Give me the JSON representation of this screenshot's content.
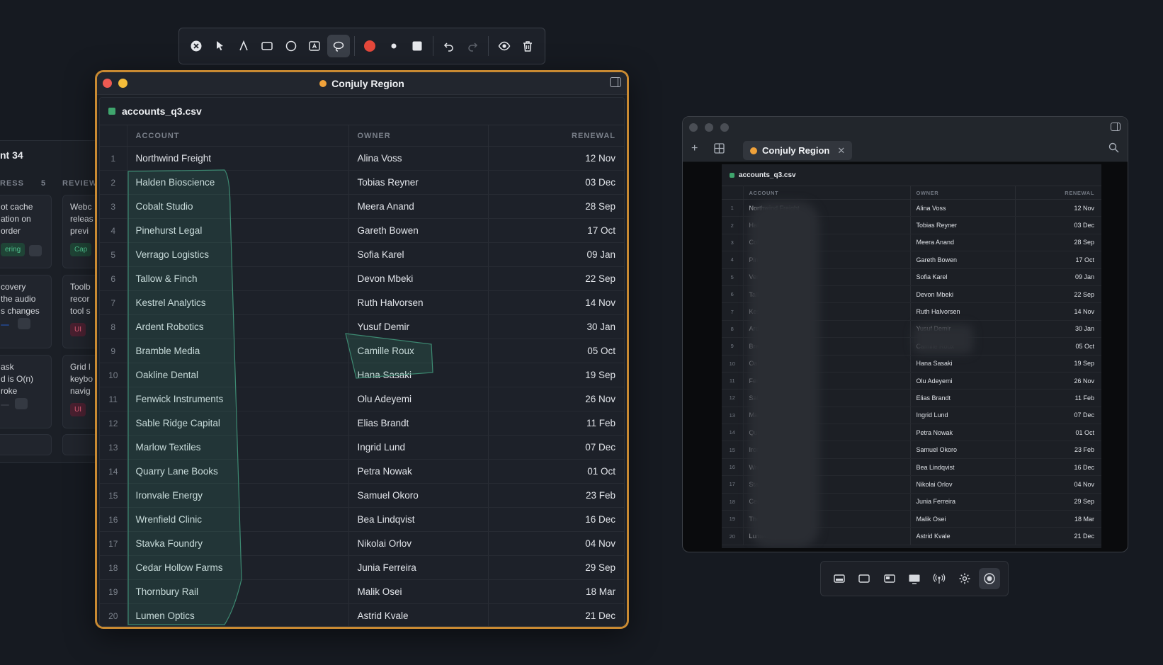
{
  "toolbar": {
    "tools": [
      {
        "name": "close-icon"
      },
      {
        "name": "arrow-pointer-icon"
      },
      {
        "name": "pen-icon"
      },
      {
        "name": "rectangle-icon"
      },
      {
        "name": "ellipse-icon"
      },
      {
        "name": "text-box-icon"
      },
      {
        "name": "lasso-icon",
        "active": true
      },
      {
        "name": "color-red-swatch",
        "color": "#e5483b"
      },
      {
        "name": "stroke-dot-icon"
      },
      {
        "name": "fill-square-icon"
      },
      {
        "name": "undo-icon"
      },
      {
        "name": "redo-icon"
      },
      {
        "name": "eye-icon"
      },
      {
        "name": "trash-icon"
      }
    ]
  },
  "kanban": {
    "title": "nt 34",
    "col1": "RESS",
    "col1_count": "5",
    "col2": "REVIEW",
    "cards_left": [
      {
        "lines": [
          "ot cache",
          "ation on",
          "order"
        ],
        "tag": "ering"
      },
      {
        "lines": [
          "covery",
          "the audio",
          "s changes"
        ],
        "tag": ""
      },
      {
        "lines": [
          "ask",
          "d is O(n)",
          "roke"
        ],
        "tag": ""
      }
    ],
    "cards_right": [
      {
        "lines": [
          "Webc",
          "releas",
          "previ"
        ],
        "tag": "Cap"
      },
      {
        "lines": [
          "Toolb",
          "recor",
          "tool s"
        ],
        "tag": "UI"
      },
      {
        "lines": [
          "Grid l",
          "keybo",
          "navig"
        ],
        "tag": "UI"
      }
    ]
  },
  "main_window": {
    "title": "Conjuly Region",
    "accent": "#c98a32",
    "dot_color": "#f0a23a",
    "file_name": "accounts_q3.csv",
    "columns": {
      "account": "ACCOUNT",
      "owner": "OWNER",
      "renewal": "RENEWAL"
    }
  },
  "rows": [
    {
      "n": "1",
      "account": "Northwind Freight",
      "owner": "Alina Voss",
      "renewal": "12 Nov"
    },
    {
      "n": "2",
      "account": "Halden Bioscience",
      "owner": "Tobias Reyner",
      "renewal": "03 Dec"
    },
    {
      "n": "3",
      "account": "Cobalt Studio",
      "owner": "Meera Anand",
      "renewal": "28 Sep"
    },
    {
      "n": "4",
      "account": "Pinehurst Legal",
      "owner": "Gareth Bowen",
      "renewal": "17 Oct"
    },
    {
      "n": "5",
      "account": "Verrago Logistics",
      "owner": "Sofia Karel",
      "renewal": "09 Jan"
    },
    {
      "n": "6",
      "account": "Tallow & Finch",
      "owner": "Devon Mbeki",
      "renewal": "22 Sep"
    },
    {
      "n": "7",
      "account": "Kestrel Analytics",
      "owner": "Ruth Halvorsen",
      "renewal": "14 Nov"
    },
    {
      "n": "8",
      "account": "Ardent Robotics",
      "owner": "Yusuf Demir",
      "renewal": "30 Jan"
    },
    {
      "n": "9",
      "account": "Bramble Media",
      "owner": "Camille Roux",
      "renewal": "05 Oct"
    },
    {
      "n": "10",
      "account": "Oakline Dental",
      "owner": "Hana Sasaki",
      "renewal": "19 Sep"
    },
    {
      "n": "11",
      "account": "Fenwick Instruments",
      "owner": "Olu Adeyemi",
      "renewal": "26 Nov"
    },
    {
      "n": "12",
      "account": "Sable Ridge Capital",
      "owner": "Elias Brandt",
      "renewal": "11 Feb"
    },
    {
      "n": "13",
      "account": "Marlow Textiles",
      "owner": "Ingrid Lund",
      "renewal": "07 Dec"
    },
    {
      "n": "14",
      "account": "Quarry Lane Books",
      "owner": "Petra Nowak",
      "renewal": "01 Oct"
    },
    {
      "n": "15",
      "account": "Ironvale Energy",
      "owner": "Samuel Okoro",
      "renewal": "23 Feb"
    },
    {
      "n": "16",
      "account": "Wrenfield Clinic",
      "owner": "Bea Lindqvist",
      "renewal": "16 Dec"
    },
    {
      "n": "17",
      "account": "Stavka Foundry",
      "owner": "Nikolai Orlov",
      "renewal": "04 Nov"
    },
    {
      "n": "18",
      "account": "Cedar Hollow Farms",
      "owner": "Junia Ferreira",
      "renewal": "29 Sep"
    },
    {
      "n": "19",
      "account": "Thornbury Rail",
      "owner": "Malik Osei",
      "renewal": "18 Mar"
    },
    {
      "n": "20",
      "account": "Lumen Optics",
      "owner": "Astrid Kvale",
      "renewal": "21 Dec"
    }
  ],
  "preview_window": {
    "tab_label": "Conjuly Region",
    "tab_close": "✕",
    "file_name": "accounts_q3.csv"
  },
  "dock": {
    "buttons": [
      {
        "name": "capture-area-icon"
      },
      {
        "name": "window-outline-icon"
      },
      {
        "name": "window-split-icon"
      },
      {
        "name": "display-icon"
      },
      {
        "name": "broadcast-icon"
      },
      {
        "name": "settings-gear-icon"
      },
      {
        "name": "record-icon",
        "active": true
      }
    ]
  }
}
